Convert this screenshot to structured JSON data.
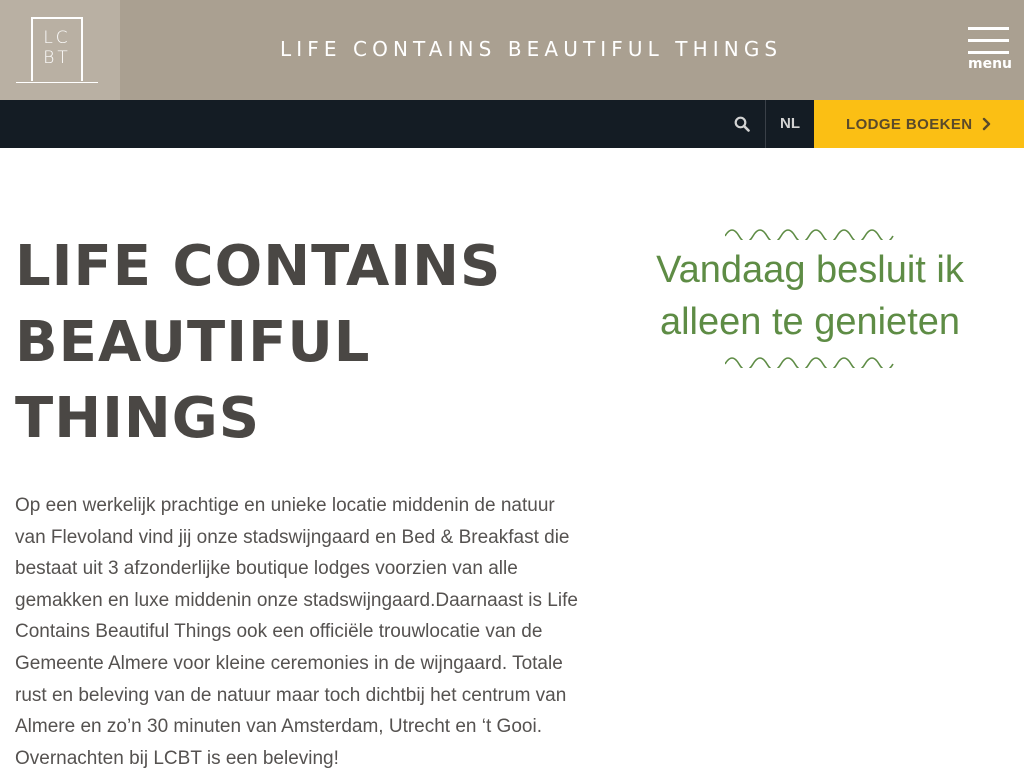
{
  "header": {
    "logo": {
      "line1": "LC",
      "line2": "BT"
    },
    "site_title": "LIFE CONTAINS BEAUTIFUL THINGS",
    "menu_label": "menu"
  },
  "navbar": {
    "search_icon": "search-icon",
    "language": "NL",
    "book_label": "LODGE BOEKEN",
    "book_icon": "chevron-right-icon"
  },
  "hero": {
    "title": "LIFE CONTAINS BEAUTIFUL THINGS",
    "intro": "Op een werkelijk prachtige en unieke locatie middenin de natuur van Flevoland vind jij onze stadswijngaard en Bed & Breakfast die bestaat uit 3 afzonderlijke boutique lodges voorzien van alle gemakken en luxe middenin onze stadswijngaard.Daarnaast is Life Contains Beautiful Things ook een officiële trouwlocatie van de Gemeente Almere voor kleine ceremonies in de wijngaard. Totale rust en beleving van de natuur maar toch dichtbij het centrum van Almere en zo’n 30 minuten van Amsterdam, Utrecht en ‘t Gooi. Overnachten bij LCBT is een beleving!"
  },
  "quote": {
    "text": "Vandaag besluit ik alleen te genieten"
  },
  "colors": {
    "header_bg": "#aaa091",
    "logo_bg": "#b9b0a3",
    "nav_bg": "#141c24",
    "accent_yellow": "#fbbf14",
    "quote_green": "#5e8c45",
    "heading_text": "#4a4744"
  }
}
